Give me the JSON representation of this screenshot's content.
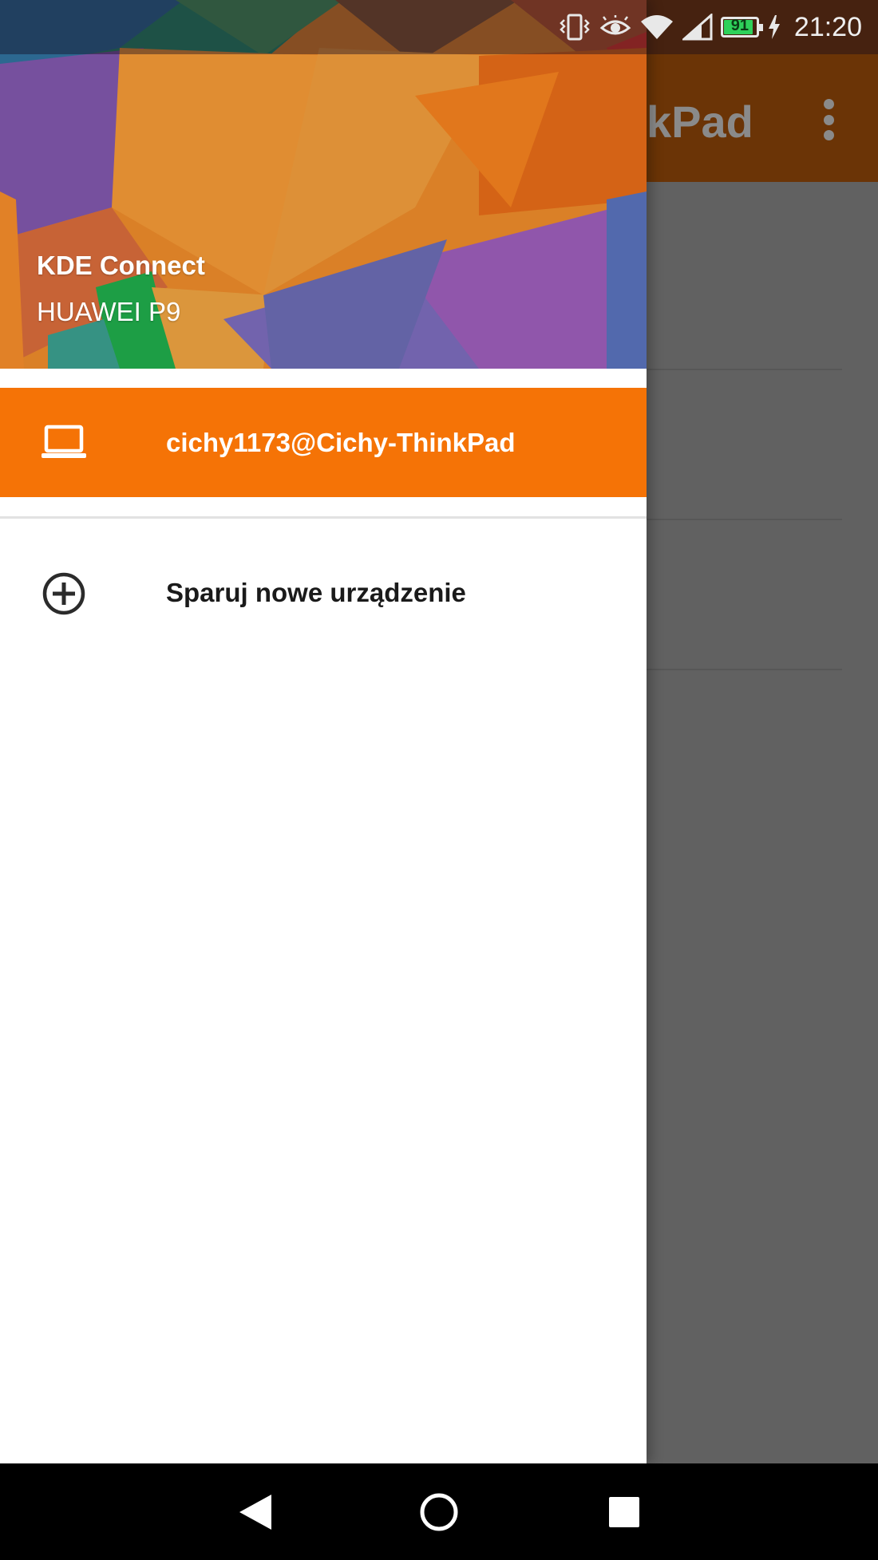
{
  "status_bar": {
    "time": "21:20",
    "battery_percent": "91",
    "battery_level": 0.91,
    "icons": [
      "vibrate-icon",
      "eye-comfort-icon",
      "wifi-icon",
      "cell-signal-icon",
      "battery-icon",
      "charging-icon"
    ]
  },
  "app_bar": {
    "title_visible": "kPad",
    "menu_icon": "more-vert-icon"
  },
  "drawer": {
    "header": {
      "app_name": "KDE Connect",
      "device_name": "HUAWEI P9"
    },
    "devices": [
      {
        "label": "cichy1173@Cichy-ThinkPad",
        "icon": "laptop-icon",
        "selected": true
      }
    ],
    "pair_new": {
      "label": "Sparuj nowe urządzenie",
      "icon": "add-circle-icon"
    }
  },
  "nav_bar": {
    "buttons": [
      "back-icon",
      "home-icon",
      "recents-icon"
    ]
  },
  "colors": {
    "accent": "#f57306",
    "scrim_toolbar": "#6b3406",
    "scrim_content": "#616161",
    "nav_bar": "#000000"
  }
}
